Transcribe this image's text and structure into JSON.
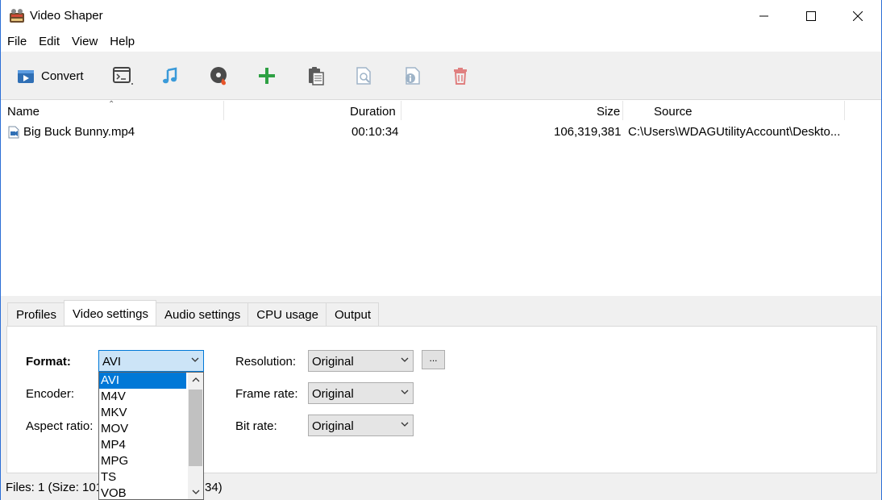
{
  "window": {
    "title": "Video Shaper"
  },
  "menu": [
    "File",
    "Edit",
    "View",
    "Help"
  ],
  "toolbar": {
    "convert_label": "Convert",
    "icons": [
      "convert-icon",
      "terminal-icon",
      "music-icon",
      "disc-burn-icon",
      "add-icon",
      "clipboard-icon",
      "preview-icon",
      "info-icon",
      "delete-icon"
    ]
  },
  "list": {
    "columns": {
      "name": "Name",
      "duration": "Duration",
      "size": "Size",
      "source": "Source"
    },
    "rows": [
      {
        "name": "Big Buck Bunny.mp4",
        "duration": "00:10:34",
        "size": "106,319,381",
        "source": "C:\\Users\\WDAGUtilityAccount\\Deskto..."
      }
    ]
  },
  "tabs": [
    "Profiles",
    "Video settings",
    "Audio settings",
    "CPU usage",
    "Output"
  ],
  "active_tab": "Video settings",
  "video_settings": {
    "format_label": "Format:",
    "format_value": "AVI",
    "encoder_label": "Encoder:",
    "aspect_label": "Aspect ratio:",
    "resolution_label": "Resolution:",
    "resolution_value": "Original",
    "framerate_label": "Frame rate:",
    "framerate_value": "Original",
    "bitrate_label": "Bit rate:",
    "bitrate_value": "Original",
    "more_button": "..."
  },
  "format_options": [
    "AVI",
    "M4V",
    "MKV",
    "MOV",
    "MP4",
    "MPG",
    "TS",
    "VOB"
  ],
  "status": {
    "left": "Files: 1 (Size: 101",
    "right": "34)"
  },
  "colors": {
    "accent": "#0078d7",
    "window_border": "#2b6fd6",
    "add_green": "#2ea043",
    "music_blue": "#3a9ad9",
    "delete_red": "#e08080"
  }
}
